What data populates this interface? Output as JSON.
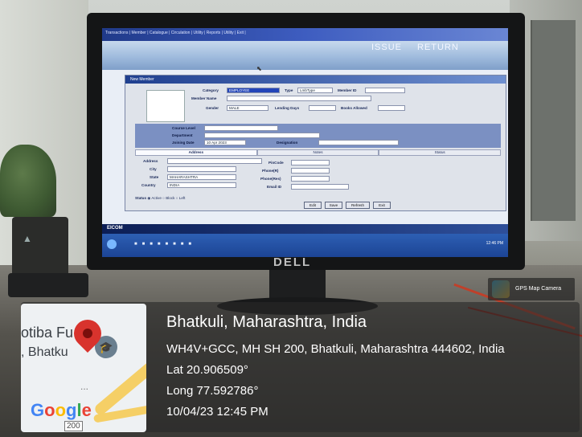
{
  "screen_app": {
    "menu_text": "Transactions | Member | Catalogue | Circulation | Utility | Reports | Utility | Exit |",
    "banner": {
      "issue": "ISSUE",
      "return": "RETURN"
    },
    "dialog": {
      "title": "New Member",
      "labels": {
        "category": "Category",
        "member_name": "Member Name",
        "gender": "Gender",
        "type": "Type",
        "member_id": "Member ID",
        "lending_days": "Lending Days",
        "books_allowed": "Books Allowed",
        "course_level": "Course Level",
        "department": "Department",
        "joining_date": "Joining Date",
        "designation": "Designation",
        "address": "Address",
        "city": "City",
        "state": "State",
        "country": "Country",
        "pincode": "PinCode",
        "phone_r": "Phone(R)",
        "phone_o": "Phone(Res)",
        "email": "Email ID",
        "status": "Status"
      },
      "values": {
        "category": "EMPLOYEE",
        "type": "LmbType",
        "gender": "MALE",
        "joining_date": "10 Apr 2023",
        "state": "MAHARASHTRA",
        "country": "INDIA"
      },
      "tabs": [
        "Address",
        "Notes",
        "Status"
      ],
      "status_options": [
        "Active",
        "Block",
        "Left"
      ],
      "buttons": {
        "edit": "Edit",
        "save": "Save",
        "refresh": "Refresh",
        "exit": "Exit"
      }
    },
    "logo_text": "EICOM",
    "clock": "12:46 PM"
  },
  "monitor_brand": "DELL",
  "gps_overlay": {
    "app_label": "GPS Map Camera",
    "place": "Bhatkuli, Maharashtra, India",
    "address": "WH4V+GCC, MH SH 200, Bhatkuli, Maharashtra 444602, India",
    "lat": "Lat 20.906509°",
    "long": "Long 77.592786°",
    "datetime": "10/04/23 12:45 PM",
    "map": {
      "text1": "otiba Fu",
      "text2": ", Bhatku",
      "google_logo": "Google",
      "route": "200"
    }
  },
  "colors": {
    "pin": "#d8332d",
    "window_blue": "#2d5fb4"
  }
}
